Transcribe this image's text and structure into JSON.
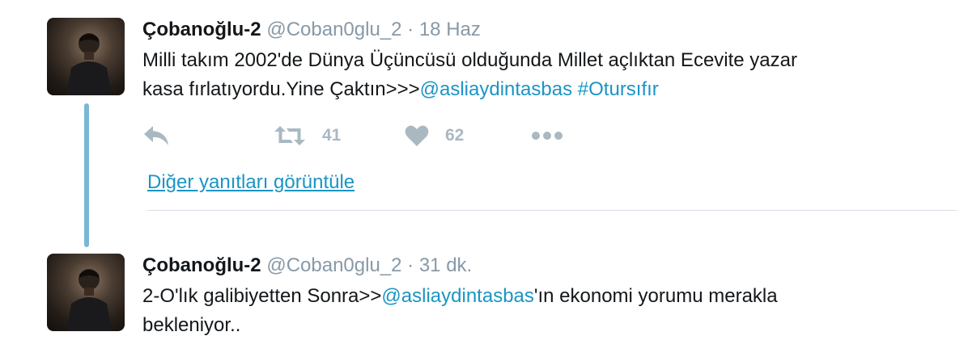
{
  "tweets": [
    {
      "display_name": "Çobanoğlu-2",
      "handle": "@Coban0glu_2",
      "separator": "·",
      "time": "18 Haz",
      "text_line1": "Milli takım 2002'de Dünya Üçüncüsü olduğunda Millet açlıktan Ecevite yazar",
      "text_line2_plain": "kasa fırlatıyordu.Yine Çaktın>>>",
      "mention": "@asliaydintasbas",
      "space": " ",
      "hashtag": "#Otursıfır",
      "retweet_count": "41",
      "like_count": "62",
      "icons": [
        "reply-icon",
        "retweet-icon",
        "heart-icon",
        "more-icon"
      ]
    },
    {
      "display_name": "Çobanoğlu-2",
      "handle": "@Coban0glu_2",
      "separator": "·",
      "time": "31 dk.",
      "text_line1_prefix": "2-O'lık galibiyetten Sonra>>",
      "mention": "@asliaydintasbas",
      "text_line1_suffix": "'ın ekonomi yorumu merakla",
      "text_line2": "bekleniyor.."
    }
  ],
  "more_replies_label": "Diğer yanıtları görüntüle",
  "colors": {
    "link": "#1b95c4",
    "thread_line": "#7ab7d6",
    "action_icon": "#aab8c2",
    "muted_text": "#8899a6"
  }
}
